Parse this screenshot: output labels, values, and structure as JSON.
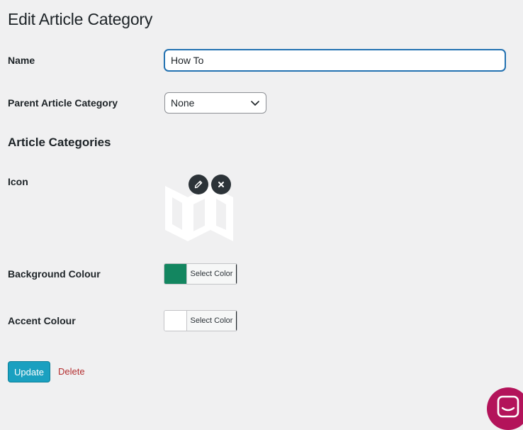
{
  "page": {
    "title": "Edit Article Category"
  },
  "fields": {
    "name": {
      "label": "Name",
      "value": "How To"
    },
    "parent": {
      "label": "Parent Article Category",
      "selected": "None"
    },
    "section_title": "Article Categories",
    "icon": {
      "label": "Icon",
      "icon": "folded-map-icon",
      "edit_icon": "pencil-icon",
      "remove_icon": "close-icon"
    },
    "background_colour": {
      "label": "Background Colour",
      "button_label": "Select Color",
      "value": "#138660"
    },
    "accent_colour": {
      "label": "Accent Colour",
      "button_label": "Select Color",
      "value": "#ffffff"
    }
  },
  "actions": {
    "update_label": "Update",
    "delete_label": "Delete"
  },
  "chat_widget": {
    "icon": "chat-bubble-icon",
    "color": "#b3135a"
  }
}
